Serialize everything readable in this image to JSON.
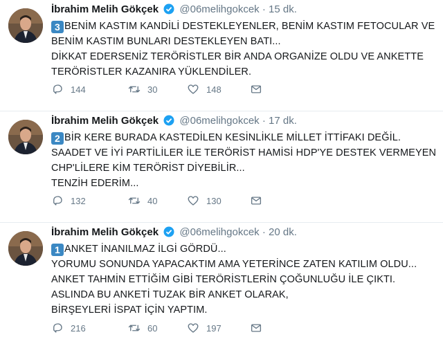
{
  "tweets": [
    {
      "name": "İbrahim Melih Gökçek",
      "handle": "@06melihgokcek",
      "dot": "·",
      "time": "15 dk.",
      "number": "3",
      "lines": [
        "BENİM KASTIM KANDİLİ DESTEKLEYENLER, BENİM KASTIM FETOCULAR VE",
        "BENİM KASTIM BUNLARI DESTEKLEYEN BATI...",
        "DİKKAT EDERSENİZ TERÖRİSTLER BİR ANDA ORGANİZE OLDU VE ANKETTE",
        "TERÖRİSTLER KAZANIRA YÜKLENDİLER."
      ],
      "replies": "144",
      "retweets": "30",
      "likes": "148"
    },
    {
      "name": "İbrahim Melih Gökçek",
      "handle": "@06melihgokcek",
      "dot": "·",
      "time": "17 dk.",
      "number": "2",
      "lines": [
        "BİR KERE BURADA KASTEDİLEN KESİNLİKLE MİLLET İTTİFAKI DEĞİL.",
        "SAADET VE İYİ PARTİLİLER İLE TERÖRİST HAMİSİ HDP'YE DESTEK VERMEYEN",
        "CHP'LİLERE KİM TERÖRİST DİYEBİLİR...",
        "TENZİH EDERİM..."
      ],
      "replies": "132",
      "retweets": "40",
      "likes": "130"
    },
    {
      "name": "İbrahim Melih Gökçek",
      "handle": "@06melihgokcek",
      "dot": "·",
      "time": "20 dk.",
      "number": "1",
      "lines": [
        "ANKET İNANILMAZ İLGİ GÖRDÜ...",
        "YORUMU SONUNDA YAPACAKTIM AMA YETERİNCE ZATEN KATILIM OLDU...",
        "ANKET TAHMİN ETTİĞİM GİBİ TERÖRİSTLERİN ÇOĞUNLUĞU İLE ÇIKTI.",
        "ASLINDA BU ANKETİ TUZAK BİR ANKET OLARAK,",
        "BİRŞEYLERİ İSPAT İÇİN YAPTIM."
      ],
      "replies": "216",
      "retweets": "60",
      "likes": "197"
    }
  ],
  "colors": {
    "verified": "#1da1f2",
    "keycap": "#3b88c3",
    "icon": "#657786",
    "text": "#14171a",
    "divider": "#e6ecf0"
  },
  "icons": [
    "avatar",
    "verified-badge-icon",
    "keycap-number-icon",
    "reply-icon",
    "retweet-icon",
    "like-icon",
    "message-icon"
  ]
}
